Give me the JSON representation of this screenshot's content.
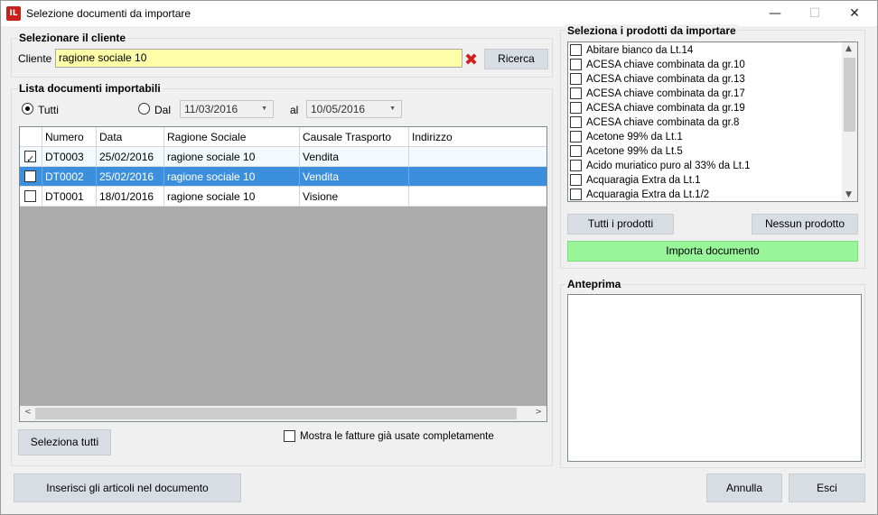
{
  "window": {
    "title": "Selezione documenti da importare",
    "icon": "app-logo-icon",
    "minimize": "—",
    "maximize": "☐",
    "close": "✕"
  },
  "cliente_section": {
    "title": "Selezionare il cliente",
    "label": "Cliente",
    "value": "ragione sociale 10",
    "clear_icon": "✖",
    "search_button": "Ricerca"
  },
  "documenti_section": {
    "title": "Lista documenti importabili",
    "radio_all": "Tutti",
    "radio_range": "Dal",
    "date_from": "11/03/2016",
    "to_label": "al",
    "date_to": "10/05/2016",
    "columns": [
      "Numero",
      "Data",
      "Ragione Sociale",
      "Causale Trasporto",
      "Indirizzo"
    ],
    "rows": [
      {
        "checked": true,
        "numero": "DT0003",
        "data": "25/02/2016",
        "ragione": "ragione sociale 10",
        "causale": "Vendita",
        "indirizzo": ""
      },
      {
        "checked": false,
        "numero": "DT0002",
        "data": "25/02/2016",
        "ragione": "ragione sociale 10",
        "causale": "Vendita",
        "indirizzo": ""
      },
      {
        "checked": false,
        "numero": "DT0001",
        "data": "18/01/2016",
        "ragione": "ragione sociale 10",
        "causale": "Visione",
        "indirizzo": ""
      }
    ],
    "selected_row": 1,
    "select_all_button": "Seleziona tutti",
    "show_used_label": "Mostra le fatture già usate completamente",
    "scroll_left": "<",
    "scroll_right": ">"
  },
  "prodotti_section": {
    "title": "Seleziona i prodotti da importare",
    "items": [
      "Abitare bianco da Lt.14",
      "ACESA chiave combinata da gr.10",
      "ACESA chiave combinata da gr.13",
      "ACESA chiave combinata da gr.17",
      "ACESA chiave combinata da gr.19",
      "ACESA chiave combinata da gr.8",
      "Acetone 99% da Lt.1",
      "Acetone 99% da Lt.5",
      "Acido muriatico puro al 33% da Lt.1",
      "Acquaragia Extra da Lt.1",
      "Acquaragia Extra da Lt.1/2"
    ],
    "all_button": "Tutti i prodotti",
    "none_button": "Nessun prodotto",
    "import_button": "Importa documento",
    "import_color": "#98f59a"
  },
  "anteprima_section": {
    "title": "Anteprima"
  },
  "footer": {
    "insert_button": "Inserisci gli articoli nel documento",
    "cancel_button": "Annulla",
    "exit_button": "Esci"
  },
  "colors": {
    "selection": "#3b8fdc",
    "input_highlight": "#ffffa8",
    "grid_background": "#ababab"
  }
}
